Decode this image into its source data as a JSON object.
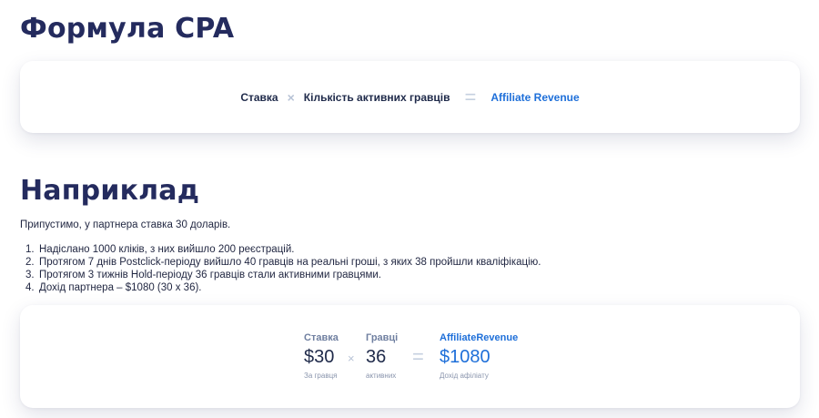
{
  "section1": {
    "title": "Формула CPA",
    "formula": {
      "rate": "Ставка",
      "times": "×",
      "players": "Кількість активних гравців",
      "equals": "=",
      "revenue": "Affiliate Revenue"
    }
  },
  "section2": {
    "title": "Наприклад",
    "intro": "Припустимо, у партнера ставка 30 доларів.",
    "steps": [
      {
        "num": "1.",
        "text": "Надіслано 1000 кліків, з них вийшло 200 реєстрацій."
      },
      {
        "num": "2.",
        "text": "Протягом 7 днів Postclick-періоду вийшло 40 гравців на реальні гроші, з яких 38 пройшли кваліфікацію."
      },
      {
        "num": "3.",
        "text": "Протягом 3 тижнів Hold-періоду 36 гравців стали активними гравцями."
      },
      {
        "num": "4.",
        "text": "Дохід партнера – $1080 (30 х 36)."
      }
    ],
    "example": {
      "rate_label": "Ставка",
      "rate_value": "$30",
      "rate_sub": "За гравця",
      "times": "×",
      "players_label": "Гравці",
      "players_value": "36",
      "players_sub": "активних",
      "equals": "=",
      "revenue_label": "AffiliateRevenue",
      "revenue_value": "$1080",
      "revenue_sub": "Дохід афіліату"
    }
  },
  "colors": {
    "heading": "#242b5e",
    "accent": "#1e6fd9",
    "operator": "#b8c3d6"
  }
}
